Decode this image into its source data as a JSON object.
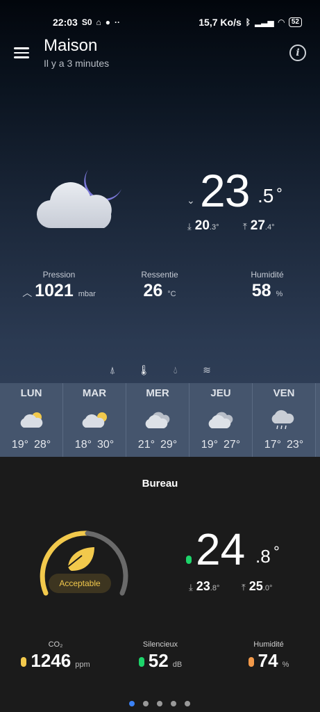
{
  "status_bar": {
    "time": "22:03",
    "left_icons": [
      "so-icon",
      "home-icon",
      "record-icon",
      "more-dots-icon"
    ],
    "speed": "15,7 Ko/s",
    "battery": "52"
  },
  "header": {
    "title": "Maison",
    "subtitle": "Il y a 3 minutes"
  },
  "current": {
    "temp_int": "23",
    "temp_dec": ".5",
    "temp_unit": "°",
    "min_int": "20",
    "min_dec": ".3",
    "max_int": "27",
    "max_dec": ".4",
    "deg": "°"
  },
  "metrics": {
    "pressure_label": "Pression",
    "pressure_value": "1021",
    "pressure_unit": "mbar",
    "feel_label": "Ressentie",
    "feel_value": "26",
    "feel_unit": "°C",
    "humidity_label": "Humidité",
    "humidity_value": "58",
    "humidity_unit": "%"
  },
  "forecast": [
    {
      "day": "LUN",
      "min": "19°",
      "max": "28°",
      "icon": "sun-cloud-icon"
    },
    {
      "day": "MAR",
      "min": "18°",
      "max": "30°",
      "icon": "sun-cloud-icon"
    },
    {
      "day": "MER",
      "min": "21°",
      "max": "29°",
      "icon": "cloudy-icon"
    },
    {
      "day": "JEU",
      "min": "19°",
      "max": "27°",
      "icon": "cloudy-icon"
    },
    {
      "day": "VEN",
      "min": "17°",
      "max": "23°",
      "icon": "rain-icon"
    }
  ],
  "room": {
    "title": "Bureau",
    "quality": "Acceptable",
    "temp_int": "24",
    "temp_dec": ".8",
    "temp_unit": "°",
    "min_int": "23",
    "min_dec": ".8",
    "max_int": "25",
    "max_dec": ".0",
    "deg": "°",
    "co2_label": "CO₂",
    "co2_value": "1246",
    "co2_unit": "ppm",
    "noise_label": "Silencieux",
    "noise_value": "52",
    "noise_unit": "dB",
    "hum_label": "Humidité",
    "hum_value": "74",
    "hum_unit": "%"
  },
  "colors": {
    "accent_yellow": "#f2c94c",
    "green": "#1dd46a",
    "orange": "#f2994a",
    "pager_active": "#3b82f6"
  }
}
